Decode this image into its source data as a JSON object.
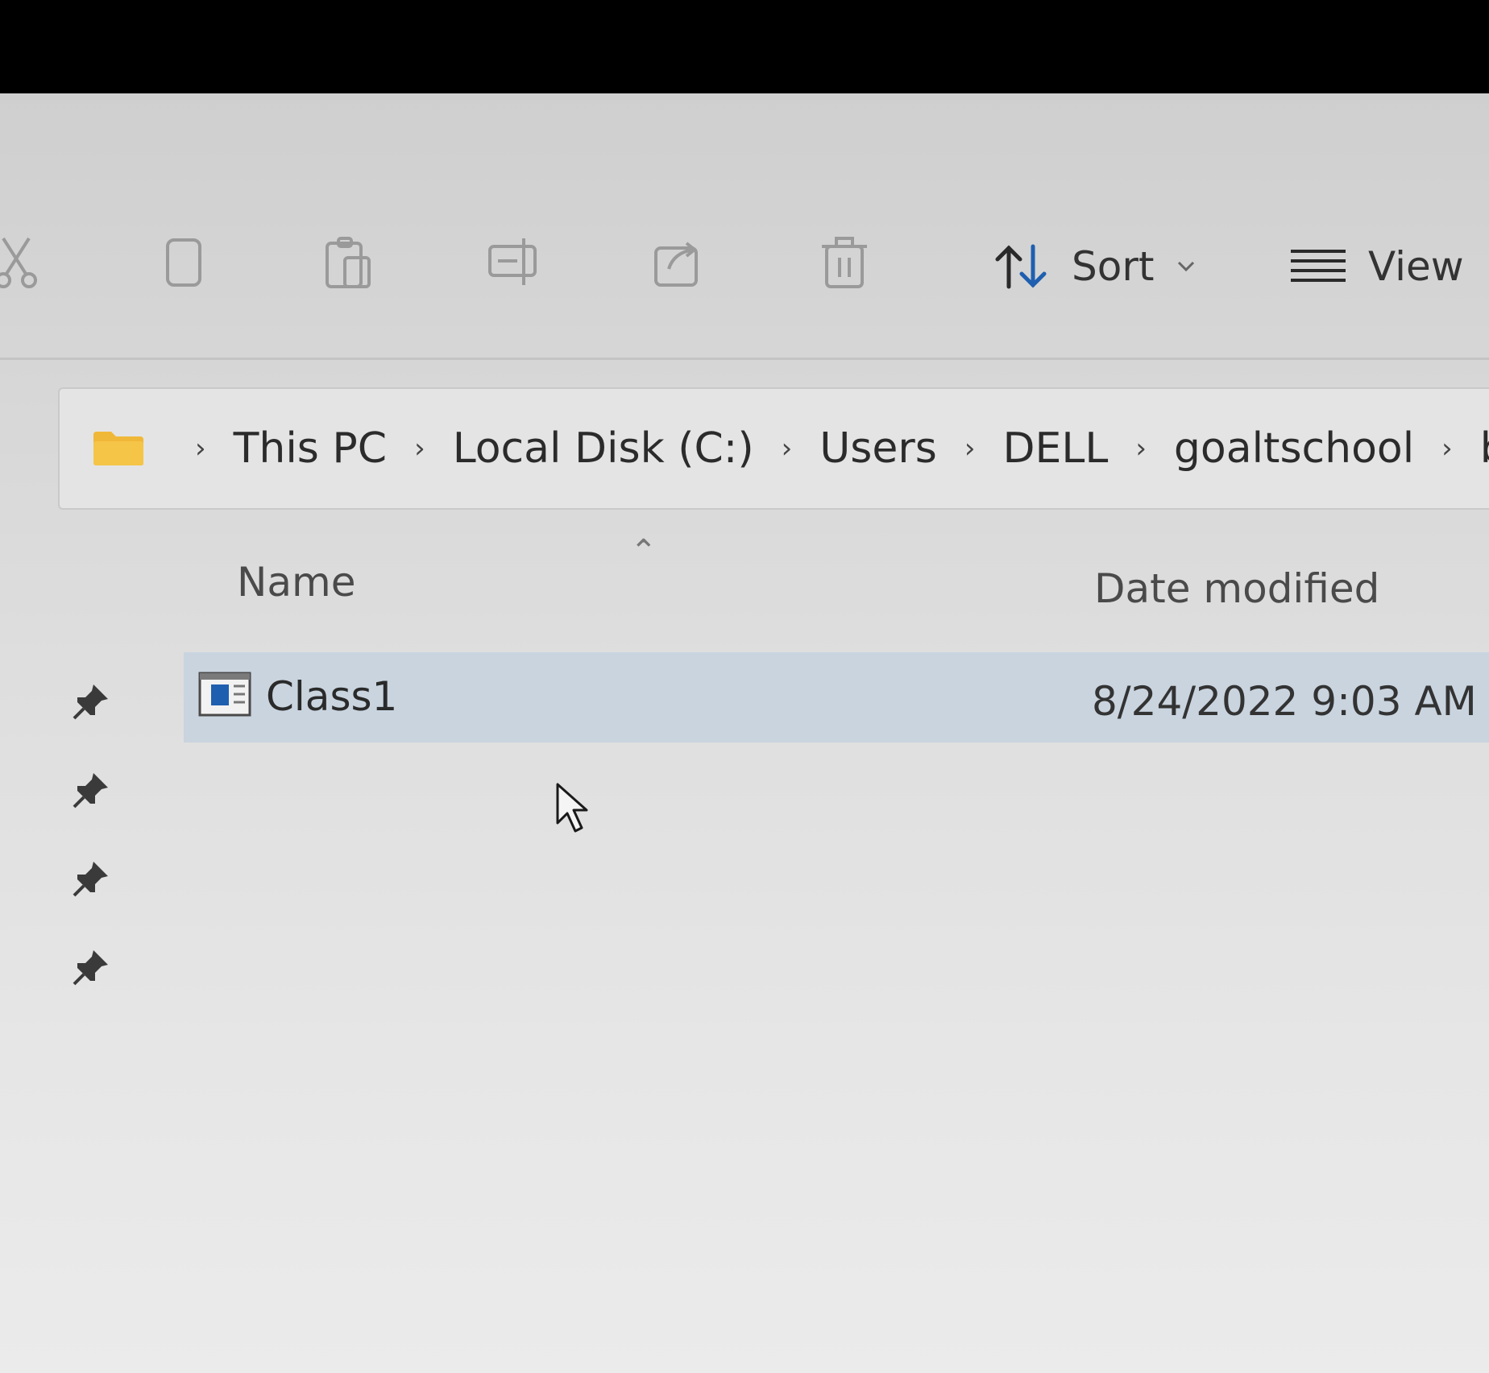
{
  "toolbar": {
    "icons": [
      "cut-icon",
      "copy-icon",
      "paste-icon",
      "rename-icon",
      "share-icon",
      "delete-icon"
    ],
    "sort_label": "Sort",
    "view_label": "View"
  },
  "breadcrumb": {
    "items": [
      "This PC",
      "Local Disk (C:)",
      "Users",
      "DELL",
      "goaltschool",
      "bin"
    ]
  },
  "columns": {
    "name": "Name",
    "date_modified": "Date modified"
  },
  "files": [
    {
      "name": "Class1",
      "date_modified": "8/24/2022 9:03 AM",
      "selected": true,
      "icon": "application-window-icon"
    }
  ],
  "quick_access_pins": 4,
  "colors": {
    "selection": "#c9d4df",
    "folder": "#f0b838",
    "file_icon_blue": "#1f5fb0"
  }
}
